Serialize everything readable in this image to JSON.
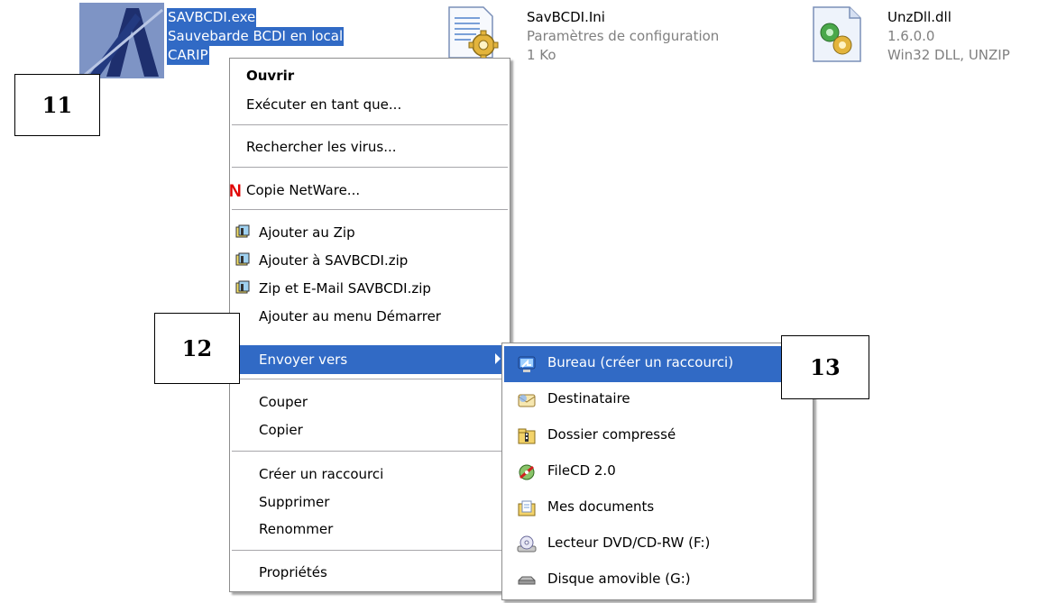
{
  "files": [
    {
      "icon": "bcdi-app-icon",
      "lines": [
        "SAVBCDI.exe",
        "Sauvebarde BCDI en local",
        "CARIP"
      ],
      "selected": true
    },
    {
      "icon": "ini-config-icon",
      "lines": [
        "SavBCDI.Ini",
        "Paramètres de configuration",
        "1 Ko"
      ]
    },
    {
      "icon": "dll-file-icon",
      "lines": [
        "UnzDll.dll",
        "1.6.0.0",
        "Win32 DLL, UNZIP"
      ]
    }
  ],
  "callouts": [
    "11",
    "12",
    "13"
  ],
  "context_menu": {
    "items": [
      {
        "label": "Ouvrir",
        "bold": true
      },
      {
        "label": "Exécuter en tant que..."
      },
      {
        "label": "Rechercher les virus..."
      },
      {
        "label": "Copie NetWare...",
        "icon": "netware-n-icon"
      },
      {
        "label": "Ajouter au Zip",
        "icon": "winzip-icon"
      },
      {
        "label": "Ajouter à SAVBCDI.zip",
        "icon": "winzip-icon"
      },
      {
        "label": "Zip et E-Mail SAVBCDI.zip",
        "icon": "winzip-icon"
      },
      {
        "label": "Ajouter au menu Démarrer"
      },
      {
        "label": "Envoyer vers",
        "highlighted": true,
        "submenu_arrow": "chevron-right-icon"
      },
      {
        "label": "Couper"
      },
      {
        "label": "Copier"
      },
      {
        "label": "Créer un raccourci"
      },
      {
        "label": "Supprimer"
      },
      {
        "label": "Renommer"
      },
      {
        "label": "Propriétés"
      }
    ]
  },
  "send_to_menu": {
    "items": [
      {
        "label": "Bureau (créer un raccourci)",
        "icon": "desktop-shortcut-icon",
        "highlighted": true
      },
      {
        "label": "Destinataire",
        "icon": "mail-recipient-icon"
      },
      {
        "label": "Dossier compressé",
        "icon": "zip-folder-icon"
      },
      {
        "label": "FileCD 2.0",
        "icon": "filecd-icon"
      },
      {
        "label": "Mes documents",
        "icon": "my-documents-icon"
      },
      {
        "label": "Lecteur DVD/CD-RW (F:)",
        "icon": "dvd-drive-icon"
      },
      {
        "label": "Disque amovible (G:)",
        "icon": "removable-disk-icon"
      }
    ]
  },
  "colors": {
    "selection": "#316ac5",
    "menu_border": "#8d8d8d",
    "secondary_text": "#808080"
  }
}
